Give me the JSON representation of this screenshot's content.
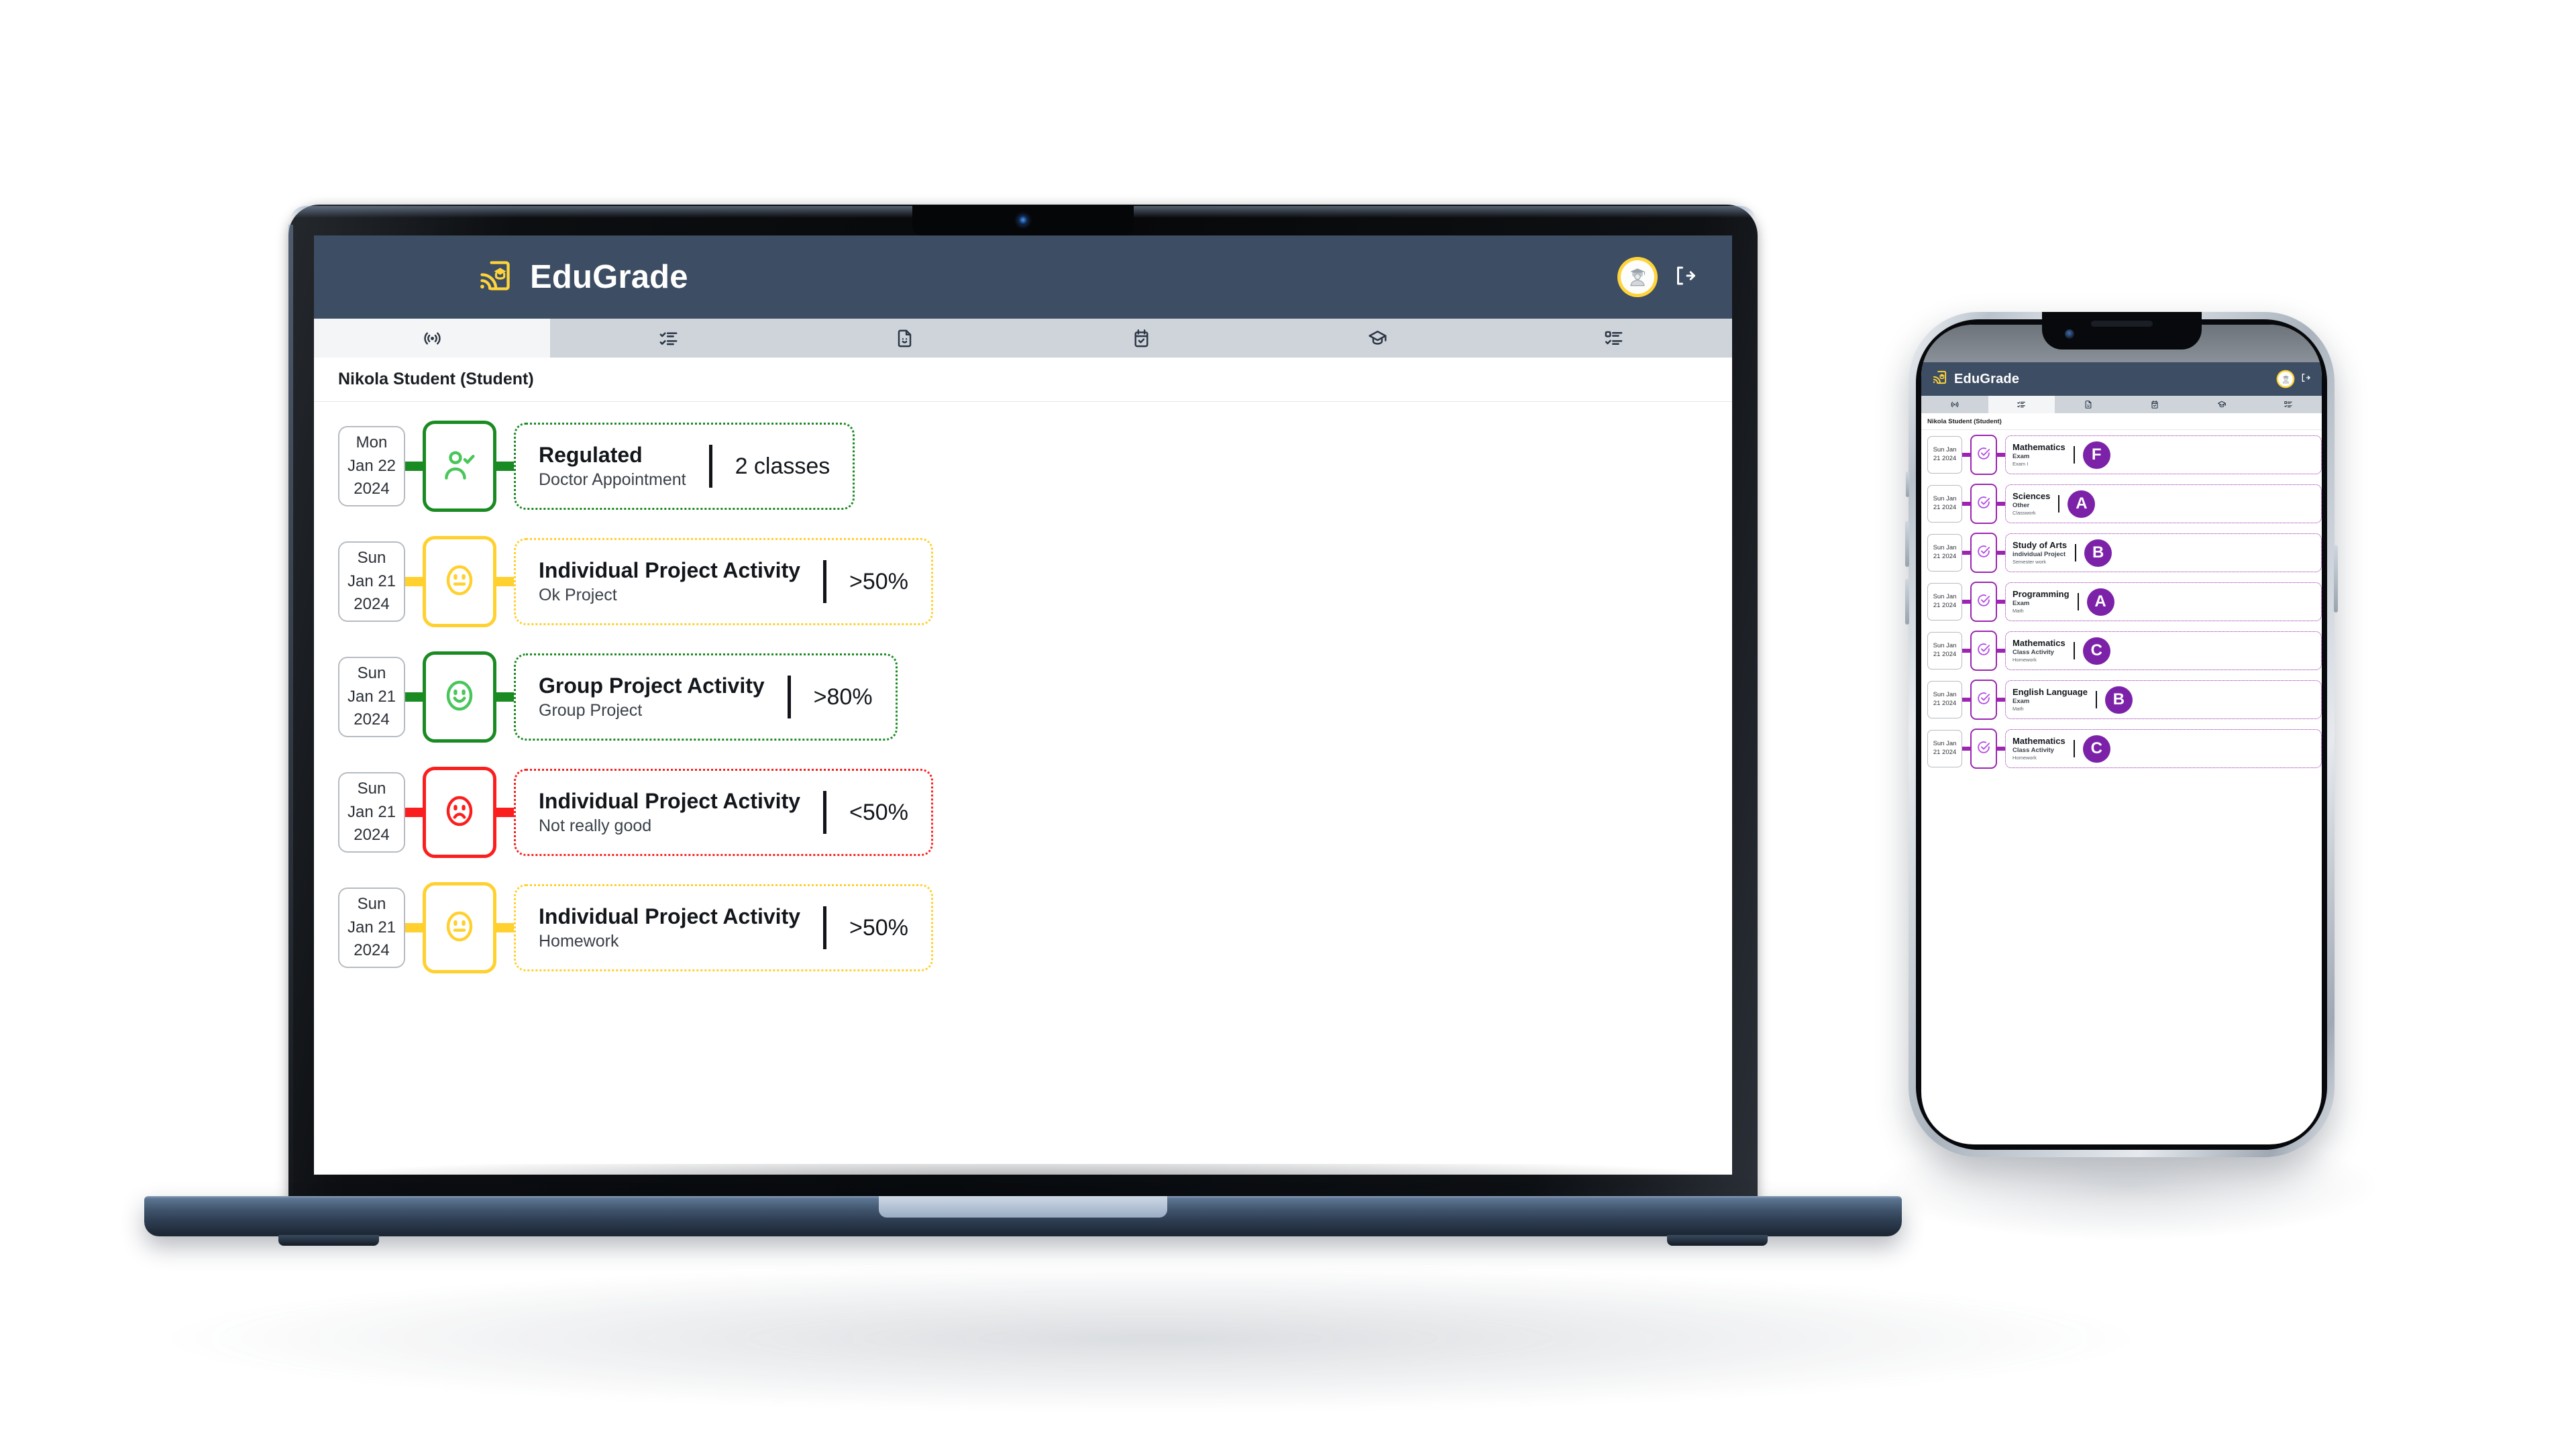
{
  "brand": {
    "name": "EduGrade",
    "logo_icon": "edugrade-broadcast-cap-logo",
    "logo_color": "#ffd43b"
  },
  "colors": {
    "header_bg": "#3d4d63",
    "tabbar_bg": "#ced4da",
    "tab_active_bg": "#f4f5f6",
    "green": "#1a8a22",
    "green_soft": "#49c65a",
    "yellow": "#ffd02e",
    "red": "#fb1e1e",
    "purple": "#9b27b0",
    "purple_dark": "#7b22a8",
    "accent_yellow": "#ffd43b"
  },
  "desktop": {
    "header": {
      "avatar_icon": "graduate-avatar-icon",
      "logout_icon": "logout-icon"
    },
    "tabs": [
      {
        "label": "Activity",
        "icon": "broadcast-icon",
        "active": true
      },
      {
        "label": "Grades",
        "icon": "checklist-icon",
        "active": false
      },
      {
        "label": "Reports",
        "icon": "document-smile-icon",
        "active": false
      },
      {
        "label": "Calendar",
        "icon": "calendar-check-icon",
        "active": false
      },
      {
        "label": "Classes",
        "icon": "graduation-cap-icon",
        "active": false
      },
      {
        "label": "Tasks",
        "icon": "list-check-icon",
        "active": false
      }
    ],
    "user_line": "Nikola Student (Student)",
    "rows": [
      {
        "date": "Mon Jan 22 2024",
        "icon": "person-check-icon",
        "color": "#1a8a22",
        "icon_color": "#49c65a",
        "title": "Regulated",
        "subtitle": "Doctor Appointment",
        "value": "2 classes"
      },
      {
        "date": "Sun Jan 21 2024",
        "icon": "neutral-face-icon",
        "color": "#ffd02e",
        "icon_color": "#ffd02e",
        "title": "Individual Project Activity",
        "subtitle": "Ok Project",
        "value": ">50%"
      },
      {
        "date": "Sun Jan 21 2024",
        "icon": "smile-face-icon",
        "color": "#1a8a22",
        "icon_color": "#49c65a",
        "title": "Group Project Activity",
        "subtitle": "Group Project",
        "value": ">80%"
      },
      {
        "date": "Sun Jan 21 2024",
        "icon": "sad-face-icon",
        "color": "#fb1e1e",
        "icon_color": "#fb1e1e",
        "title": "Individual Project Activity",
        "subtitle": "Not really good",
        "value": "<50%"
      },
      {
        "date": "Sun Jan 21 2024",
        "icon": "neutral-face-icon",
        "color": "#ffd02e",
        "icon_color": "#ffd02e",
        "title": "Individual Project Activity",
        "subtitle": "Homework",
        "value": ">50%"
      }
    ]
  },
  "phone": {
    "header": {
      "avatar_icon": "graduate-avatar-icon",
      "logout_icon": "logout-icon"
    },
    "tabs": [
      {
        "label": "Activity",
        "icon": "broadcast-icon",
        "active": false
      },
      {
        "label": "Grades",
        "icon": "checklist-icon",
        "active": true
      },
      {
        "label": "Reports",
        "icon": "document-smile-icon",
        "active": false
      },
      {
        "label": "Calendar",
        "icon": "calendar-check-icon",
        "active": false
      },
      {
        "label": "Classes",
        "icon": "graduation-cap-icon",
        "active": false
      },
      {
        "label": "Tasks",
        "icon": "list-check-icon",
        "active": false
      }
    ],
    "user_line": "Nikola Student (Student)",
    "rows": [
      {
        "date": "Sun Jan 21 2024",
        "icon": "check-circle-icon",
        "color": "#9b27b0",
        "title": "Mathematics",
        "subtitle": "Exam",
        "detail": "Exam I",
        "grade": "F"
      },
      {
        "date": "Sun Jan 21 2024",
        "icon": "check-circle-icon",
        "color": "#9b27b0",
        "title": "Sciences",
        "subtitle": "Other",
        "detail": "Classwork",
        "grade": "A"
      },
      {
        "date": "Sun Jan 21 2024",
        "icon": "check-circle-icon",
        "color": "#9b27b0",
        "title": "Study of Arts",
        "subtitle": "individual Project",
        "detail": "Semester work",
        "grade": "B"
      },
      {
        "date": "Sun Jan 21 2024",
        "icon": "check-circle-icon",
        "color": "#9b27b0",
        "title": "Programming",
        "subtitle": "Exam",
        "detail": "Math",
        "grade": "A"
      },
      {
        "date": "Sun Jan 21 2024",
        "icon": "check-circle-icon",
        "color": "#9b27b0",
        "title": "Mathematics",
        "subtitle": "Class Activity",
        "detail": "Homework",
        "grade": "C"
      },
      {
        "date": "Sun Jan 21 2024",
        "icon": "check-circle-icon",
        "color": "#9b27b0",
        "title": "English Language",
        "subtitle": "Exam",
        "detail": "Math",
        "grade": "B"
      },
      {
        "date": "Sun Jan 21 2024",
        "icon": "check-circle-icon",
        "color": "#9b27b0",
        "title": "Mathematics",
        "subtitle": "Class Activity",
        "detail": "Homework",
        "grade": "C"
      }
    ]
  }
}
